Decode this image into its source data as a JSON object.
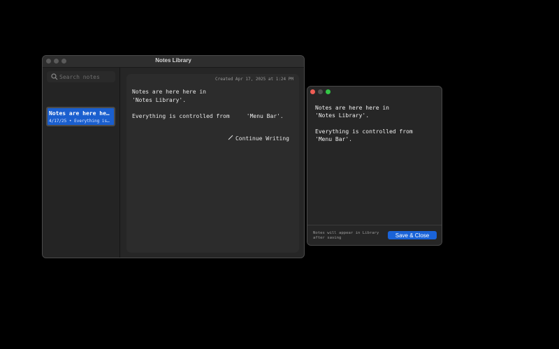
{
  "library_window": {
    "title": "Notes Library",
    "search": {
      "placeholder": "Search notes"
    },
    "notes": [
      {
        "title": "Notes are here he…",
        "meta": "4/17/25 • Everything is…",
        "selected": true
      }
    ],
    "content": {
      "created": "Created Apr 17, 2025 at 1:24 PM",
      "lines": [
        "Notes are here here in",
        "'Notes Library'.",
        "",
        "Everything is controlled from     'Menu Bar'."
      ],
      "continue_label": "Continue Writing"
    }
  },
  "editor_window": {
    "lines": [
      "Notes are here here in",
      "'Notes Library'.",
      "",
      "Everything is controlled from",
      "'Menu Bar'."
    ],
    "footer_note": "Notes will appear in Library after saving",
    "save_label": "Save & Close"
  },
  "colors": {
    "accent": "#1a63d8",
    "selected_note": "#1a5fcf",
    "close": "#ee5d54",
    "zoom": "#34c646"
  },
  "icons": [
    "search-icon",
    "pencil-icon",
    "close-icon",
    "minimize-icon",
    "zoom-icon"
  ]
}
